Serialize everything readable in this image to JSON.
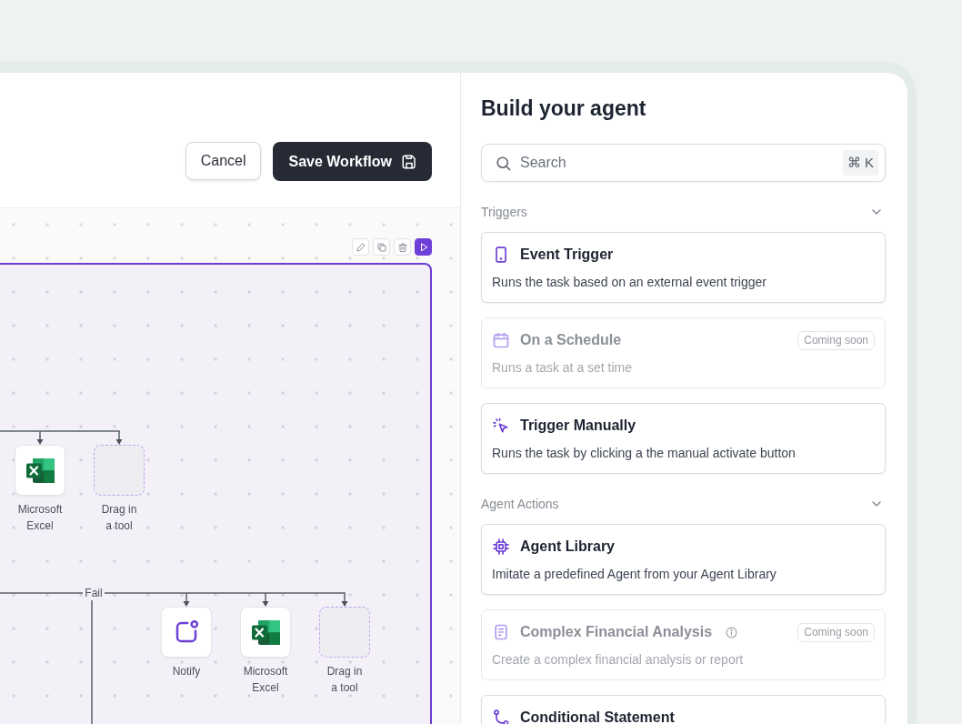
{
  "header": {
    "buttons": [
      {
        "label": "Cancel",
        "kind": "secondary"
      },
      {
        "label": "Save Workflow",
        "kind": "primary"
      }
    ]
  },
  "canvas": {
    "branches": [
      {
        "nodes": [
          {
            "kind": "excel",
            "label": "Microsoft Excel"
          },
          {
            "kind": "placeholder",
            "label": "Drag in a tool"
          }
        ]
      },
      {
        "label": "Fail",
        "nodes": [
          {
            "kind": "notify",
            "label": "Notify"
          },
          {
            "kind": "excel",
            "label": "Microsoft Excel"
          },
          {
            "kind": "placeholder",
            "label": "Drag in a tool"
          }
        ]
      }
    ]
  },
  "panel": {
    "title": "Build your agent",
    "search": {
      "placeholder": "Search",
      "shortcut": "⌘ K"
    },
    "sections": [
      {
        "title": "Triggers",
        "expanded": true,
        "items": [
          {
            "kind": "event",
            "title": "Event Trigger",
            "description": "Runs the task based on an external event trigger",
            "disabled": false,
            "info": false
          },
          {
            "kind": "schedule",
            "title": "On a Schedule",
            "description": "Runs a task at a set time",
            "disabled": true,
            "info": false,
            "badge": "Coming soon"
          },
          {
            "kind": "manual",
            "title": "Trigger Manually",
            "description": "Runs the task by clicking a the manual activate button",
            "disabled": false,
            "info": false
          }
        ]
      },
      {
        "title": "Agent Actions",
        "expanded": true,
        "items": [
          {
            "kind": "library",
            "title": "Agent Library",
            "description": "Imitate a predefined Agent from your Agent Library",
            "disabled": false,
            "info": false
          },
          {
            "kind": "analysis",
            "title": "Complex Financial Analysis",
            "description": "Create a complex financial analysis or report",
            "disabled": true,
            "info": true,
            "badge": "Coming soon"
          },
          {
            "kind": "conditional",
            "title": "Conditional Statement",
            "disabled": false,
            "info": false
          }
        ]
      }
    ]
  }
}
